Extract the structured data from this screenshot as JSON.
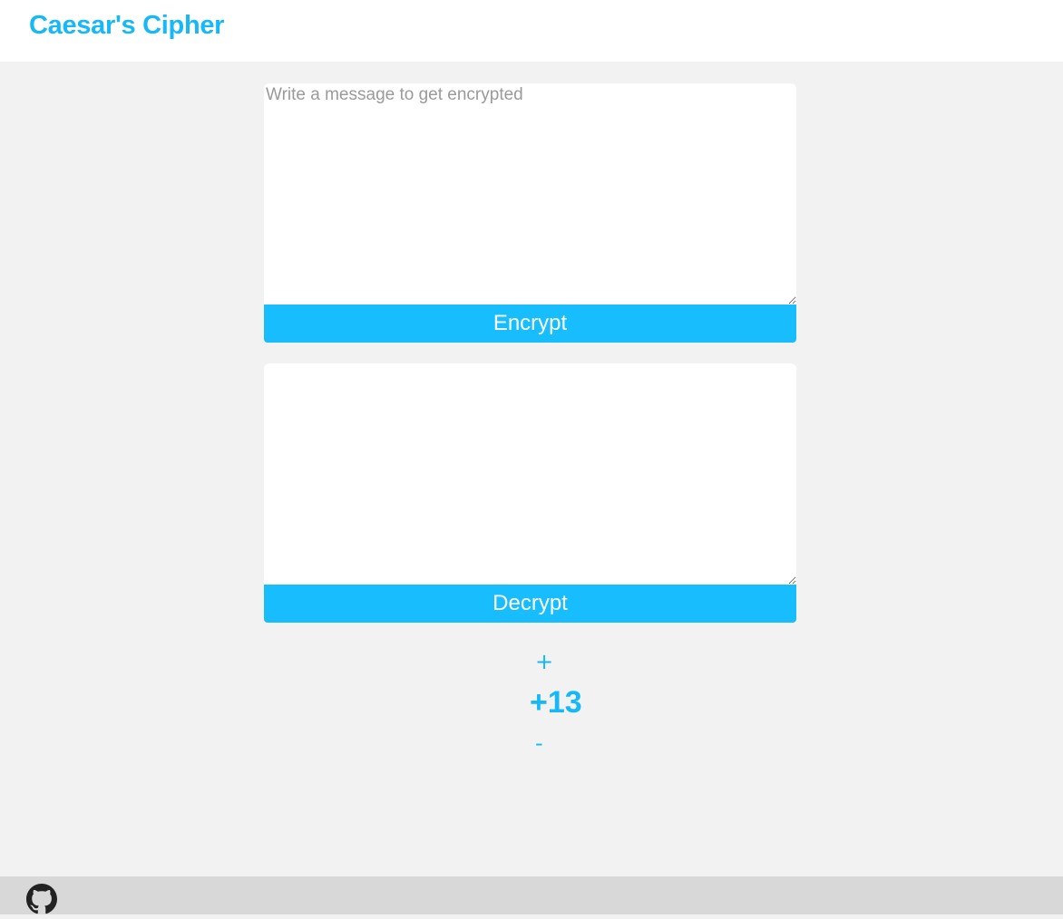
{
  "header": {
    "title": "Caesar's Cipher"
  },
  "encrypt": {
    "input_value": "",
    "placeholder": "Write a message to get encrypted",
    "button_label": "Encrypt"
  },
  "decrypt": {
    "input_value": "",
    "placeholder": "",
    "button_label": "Decrypt"
  },
  "shift": {
    "increment_label": "+",
    "value": "+13",
    "decrement_label": "-"
  },
  "footer": {
    "icon": "github-icon"
  },
  "colors": {
    "accent": "#17b8f7",
    "page_background": "#f2f2f2",
    "footer_background": "#d8d8d8"
  }
}
